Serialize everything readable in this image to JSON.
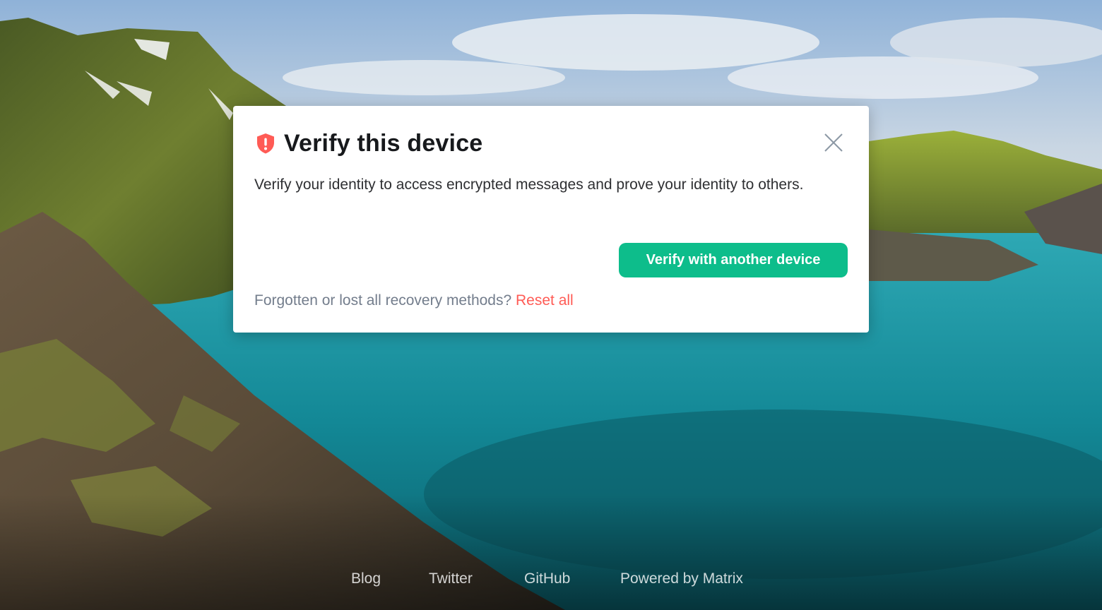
{
  "dialog": {
    "title": "Verify this device",
    "description": "Verify your identity to access encrypted messages and prove your identity to others.",
    "primary_button": "Verify with another device",
    "recovery_prompt": "Forgotten or lost all recovery methods?",
    "reset_link": "Reset all",
    "icons": {
      "shield": "shield-warning-icon",
      "close": "close-icon"
    }
  },
  "footer": {
    "links": [
      "Blog",
      "Twitter",
      "GitHub",
      "Powered by Matrix"
    ]
  },
  "colors": {
    "accent": "#0dbd8b",
    "alert": "#ff5b55",
    "title": "#17191c",
    "secondary_text": "#737d8c"
  }
}
